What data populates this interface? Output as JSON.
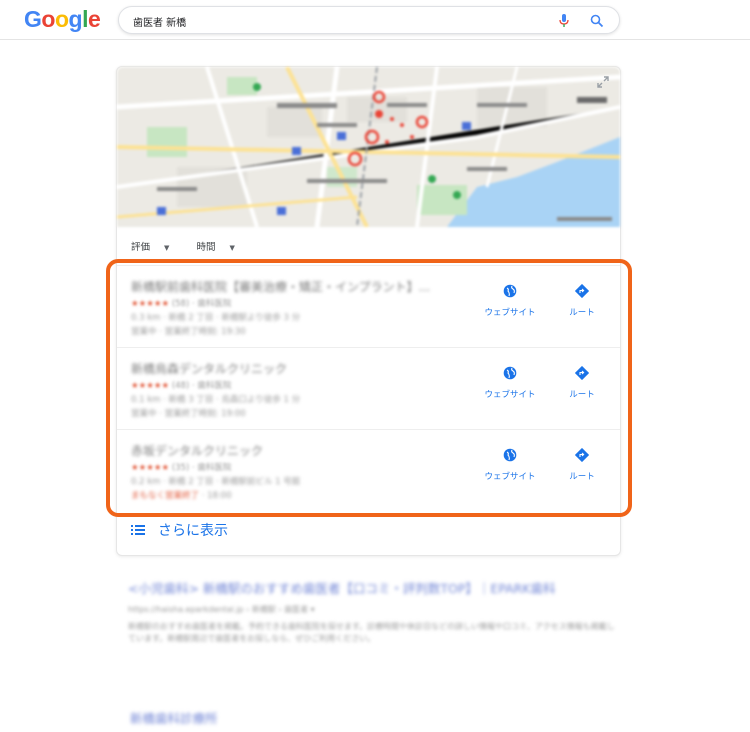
{
  "header": {
    "logo_letters": [
      {
        "ch": "G",
        "color": "#4285f4"
      },
      {
        "ch": "o",
        "color": "#ea4335"
      },
      {
        "ch": "o",
        "color": "#fbbc05"
      },
      {
        "ch": "g",
        "color": "#4285f4"
      },
      {
        "ch": "l",
        "color": "#34a853"
      },
      {
        "ch": "e",
        "color": "#ea4335"
      }
    ],
    "search_query": "歯医者 新橋",
    "mic_icon": "mic-icon",
    "search_icon": "search-icon"
  },
  "local_pack": {
    "map_icon": "expand-icon",
    "filters": [
      "評価",
      "時間"
    ],
    "results": [
      {
        "name": "新橋駅前歯科医院【審美治療・矯正・インプラント】...",
        "stars": "★★★★★",
        "rating_rest": "(58) · 歯科医院",
        "address": "0.3 km · 新橋 2 丁目 · 新橋駅より徒歩 3 分",
        "hours": "営業中 · 営業終了時刻: 19:30",
        "hours_flag": "",
        "website_label": "ウェブサイト",
        "route_label": "ルート"
      },
      {
        "name": "新橋烏森デンタルクリニック",
        "stars": "★★★★★",
        "rating_rest": "(48) · 歯科医院",
        "address": "0.1 km · 新橋 3 丁目 · 烏森口より徒歩 1 分",
        "hours": "営業中 · 営業終了時刻: 19:00",
        "hours_flag": "",
        "website_label": "ウェブサイト",
        "route_label": "ルート"
      },
      {
        "name": "赤坂デンタルクリニック",
        "stars": "★★★★★",
        "rating_rest": "(35) · 歯科医院",
        "address": "0.2 km · 新橋 2 丁目 · 新橋駅前ビル 1 号館",
        "hours": "まもなく営業終了",
        "hours_flag": "· 18:00",
        "website_label": "ウェブサイト",
        "route_label": "ルート"
      }
    ],
    "more_label": "さらに表示"
  },
  "organic": {
    "title": "<小児歯科> 新橋駅のおすすめ歯医者【口コミ・評判数TOP】｜EPARK歯科",
    "url": "https://haisha.eparkdental.jp › 新橋駅 › 歯医者 ▾",
    "snippet": "新橋駅のおすすめ歯医者を掲載。予約できる歯科医院を探せます。診療時間や休診日などの詳しい情報や口コミ、アクセス情報も掲載しています。新橋駅周辺で歯医者をお探しなら、ぜひご利用ください。",
    "next_title": "新橋歯科診療所"
  },
  "colors": {
    "accent_blue": "#1a73e8",
    "highlight_orange": "#f06419",
    "star_red": "#e25b3c"
  }
}
